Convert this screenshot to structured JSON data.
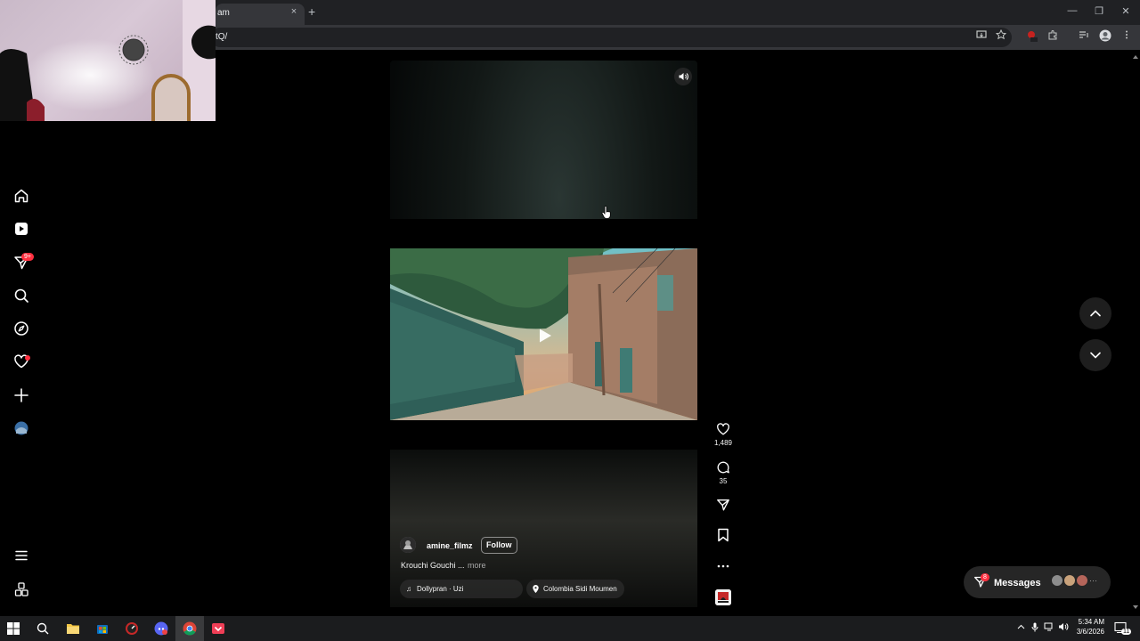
{
  "browser": {
    "tab_title": "am",
    "tab_close": "×",
    "new_tab": "+",
    "url": "tQ/",
    "window_controls": [
      "—",
      "❐",
      "✕"
    ]
  },
  "sidebar": {
    "icons": [
      "home-icon",
      "reels-icon",
      "direct-icon",
      "search-icon",
      "explore-icon",
      "notifications-icon",
      "create-icon",
      "profile-icon",
      "menu-icon",
      "more-apps-icon"
    ],
    "notification_badge": "9+"
  },
  "reel": {
    "username": "amine_filmz",
    "follow_label": "Follow",
    "caption": "Krouchi Gouchi ...",
    "caption_more": "more",
    "audio": "Dollypran · Uzi",
    "location": "Colombia Sidi Moumen",
    "likes": "1,489",
    "comments": "35"
  },
  "messages": {
    "label": "Messages",
    "badge": "8",
    "more": "···"
  },
  "taskbar": {
    "time": "5:34 AM",
    "date": "3/6/2026",
    "notification_count": "11"
  },
  "colors": {
    "badge": "#ff3040",
    "background": "#000000",
    "taskbar": "#1b1c1e"
  }
}
